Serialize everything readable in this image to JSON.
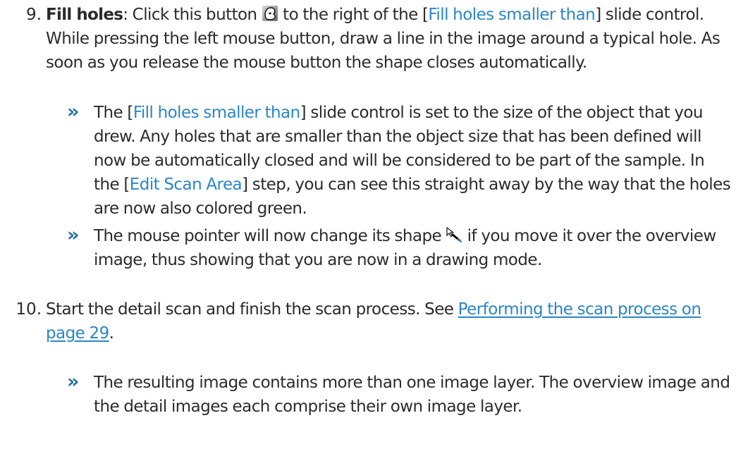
{
  "step9": {
    "number": "9.",
    "term": "Fill holes",
    "t1": ": Click this button ",
    "icon_name": "fill-holes-icon",
    "t2": " to the right of the [",
    "ui1": "Fill holes smaller than",
    "t3": "] slide control. While pressing the left mouse button, draw a line in the image around a typical hole. As soon as you release the mouse button the shape closes automatically.",
    "result1": {
      "marker": "»",
      "t1": "The [",
      "ui1": "Fill holes smaller than",
      "t2": "] slide control is set to the size of the object that you drew. Any holes that are smaller than the object size that has been defined will now be automatically closed and will be considered to be part of the sample. In the [",
      "ui2": "Edit Scan Area",
      "t3": "] step, you can see this straight away by the way that the holes are now also colored green."
    },
    "result2": {
      "marker": "»",
      "t1": "The mouse pointer will now change its shape ",
      "icon_name": "drawing-pointer-icon",
      "t2": " if you move it over the overview image, thus showing that you are now in a drawing mode."
    }
  },
  "step10": {
    "number": "10.",
    "t1": "Start the detail scan and finish the scan process. See ",
    "link": "Performing the scan process on page 29",
    "t2": ".",
    "result1": {
      "marker": "»",
      "text": "The resulting image contains more than one image layer. The overview image and the detail images each comprise their own image layer."
    }
  },
  "colors": {
    "text": "#2b2b2b",
    "ui_reference": "#2a86c6",
    "result_marker": "#1f6fa8"
  }
}
